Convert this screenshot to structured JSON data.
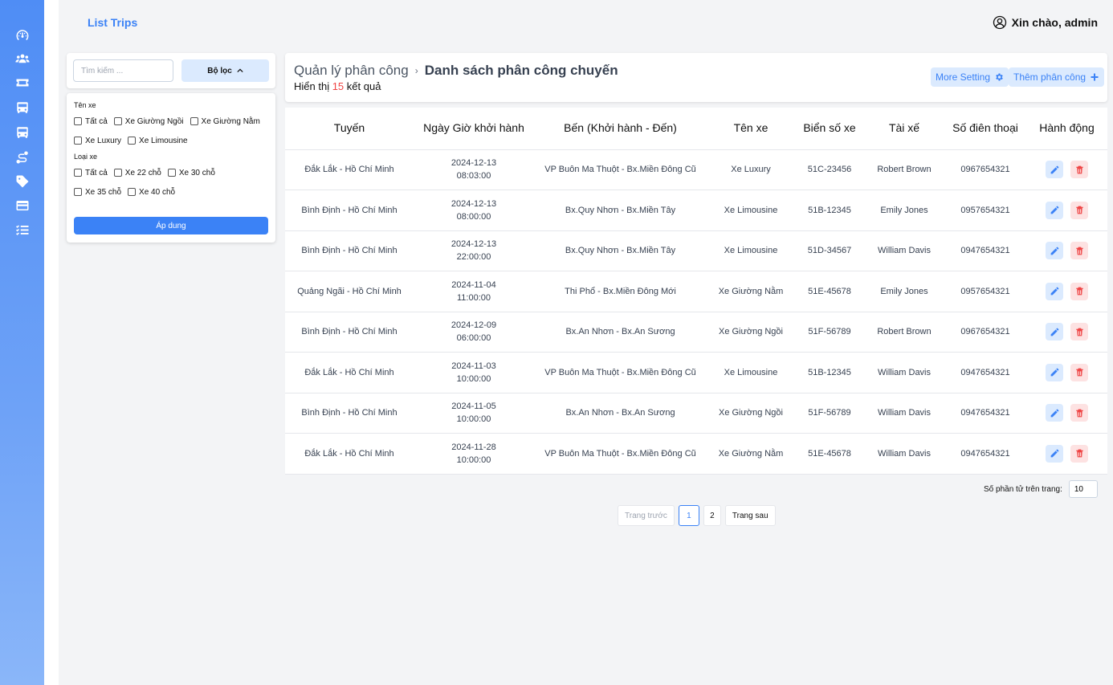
{
  "app": {
    "title": "List Trips",
    "greeting": "Xin chào, admin"
  },
  "sidebar": {
    "items": [
      {
        "icon": "dashboard-icon"
      },
      {
        "icon": "users-icon"
      },
      {
        "icon": "ticket-icon"
      },
      {
        "icon": "bus-icon"
      },
      {
        "icon": "bus-icon"
      },
      {
        "icon": "route-icon"
      },
      {
        "icon": "tag-icon"
      },
      {
        "icon": "credit-card-icon"
      },
      {
        "icon": "task-list-icon"
      }
    ]
  },
  "filter": {
    "search_placeholder": "Tìm kiếm ...",
    "toggle_label": "Bộ lọc",
    "group1_label": "Tên xe",
    "group1_options": [
      "Tất cả",
      "Xe Giường Ngồi",
      "Xe Giường Nằm",
      "Xe Luxury",
      "Xe Limousine"
    ],
    "group2_label": "Loại xe",
    "group2_options": [
      "Tất cả",
      "Xe 22 chỗ",
      "Xe 30 chỗ",
      "Xe 35 chỗ",
      "Xe 40 chỗ"
    ],
    "apply_label": "Áp dung"
  },
  "header": {
    "breadcrumb_parent": "Quản lý phân công",
    "breadcrumb_current": "Danh sách phân công chuyến",
    "result_prefix": "Hiển thị",
    "result_count": "15",
    "result_suffix": "kết quả",
    "more_setting_label": "More Setting",
    "add_label": "Thêm phân công"
  },
  "table": {
    "columns": [
      "Tuyến",
      "Ngày Giờ khởi hành",
      "Bến (Khởi hành - Đến)",
      "Tên xe",
      "Biển số xe",
      "Tài xế",
      "Số điên thoại",
      "Hành động"
    ],
    "rows": [
      {
        "route": "Đắk Lắk - Hồ Chí Minh",
        "date": "2024-12-13",
        "time": "08:03:00",
        "station": "VP Buôn Ma Thuột - Bx.Miền Đông Cũ",
        "bus": "Xe Luxury",
        "plate": "51C-23456",
        "driver": "Robert Brown",
        "phone": "0967654321"
      },
      {
        "route": "Bình Định - Hồ Chí Minh",
        "date": "2024-12-13",
        "time": "08:00:00",
        "station": "Bx.Quy Nhơn - Bx.Miền Tây",
        "bus": "Xe Limousine",
        "plate": "51B-12345",
        "driver": "Emily Jones",
        "phone": "0957654321"
      },
      {
        "route": "Bình Định - Hồ Chí Minh",
        "date": "2024-12-13",
        "time": "22:00:00",
        "station": "Bx.Quy Nhơn - Bx.Miền Tây",
        "bus": "Xe Limousine",
        "plate": "51D-34567",
        "driver": "William Davis",
        "phone": "0947654321"
      },
      {
        "route": "Quảng Ngãi - Hồ Chí Minh",
        "date": "2024-11-04",
        "time": "11:00:00",
        "station": "Thi Phổ - Bx.Miền Đông Mới",
        "bus": "Xe Giường Nằm",
        "plate": "51E-45678",
        "driver": "Emily Jones",
        "phone": "0957654321"
      },
      {
        "route": "Bình Định - Hồ Chí Minh",
        "date": "2024-12-09",
        "time": "06:00:00",
        "station": "Bx.An Nhơn - Bx.An Sương",
        "bus": "Xe Giường Ngồi",
        "plate": "51F-56789",
        "driver": "Robert Brown",
        "phone": "0967654321"
      },
      {
        "route": "Đắk Lắk - Hồ Chí Minh",
        "date": "2024-11-03",
        "time": "10:00:00",
        "station": "VP Buôn Ma Thuột - Bx.Miền Đông Cũ",
        "bus": "Xe Limousine",
        "plate": "51B-12345",
        "driver": "William Davis",
        "phone": "0947654321"
      },
      {
        "route": "Bình Định - Hồ Chí Minh",
        "date": "2024-11-05",
        "time": "10:00:00",
        "station": "Bx.An Nhơn - Bx.An Sương",
        "bus": "Xe Giường Ngồi",
        "plate": "51F-56789",
        "driver": "William Davis",
        "phone": "0947654321"
      },
      {
        "route": "Đắk Lắk - Hồ Chí Minh",
        "date": "2024-11-28",
        "time": "10:00:00",
        "station": "VP Buôn Ma Thuột - Bx.Miền Đông Cũ",
        "bus": "Xe Giường Nằm",
        "plate": "51E-45678",
        "driver": "William Davis",
        "phone": "0947654321"
      }
    ]
  },
  "pagination": {
    "page_size_label": "Số phần tử trên trang:",
    "page_size_value": "10",
    "prev_label": "Trang trước",
    "pages": [
      "1",
      "2"
    ],
    "current_page": "1",
    "next_label": "Trang sau"
  },
  "colors": {
    "accent": "#3b82f6",
    "danger": "#ef4444",
    "accent_light": "#dbeafe",
    "danger_light": "#fde2e2"
  }
}
